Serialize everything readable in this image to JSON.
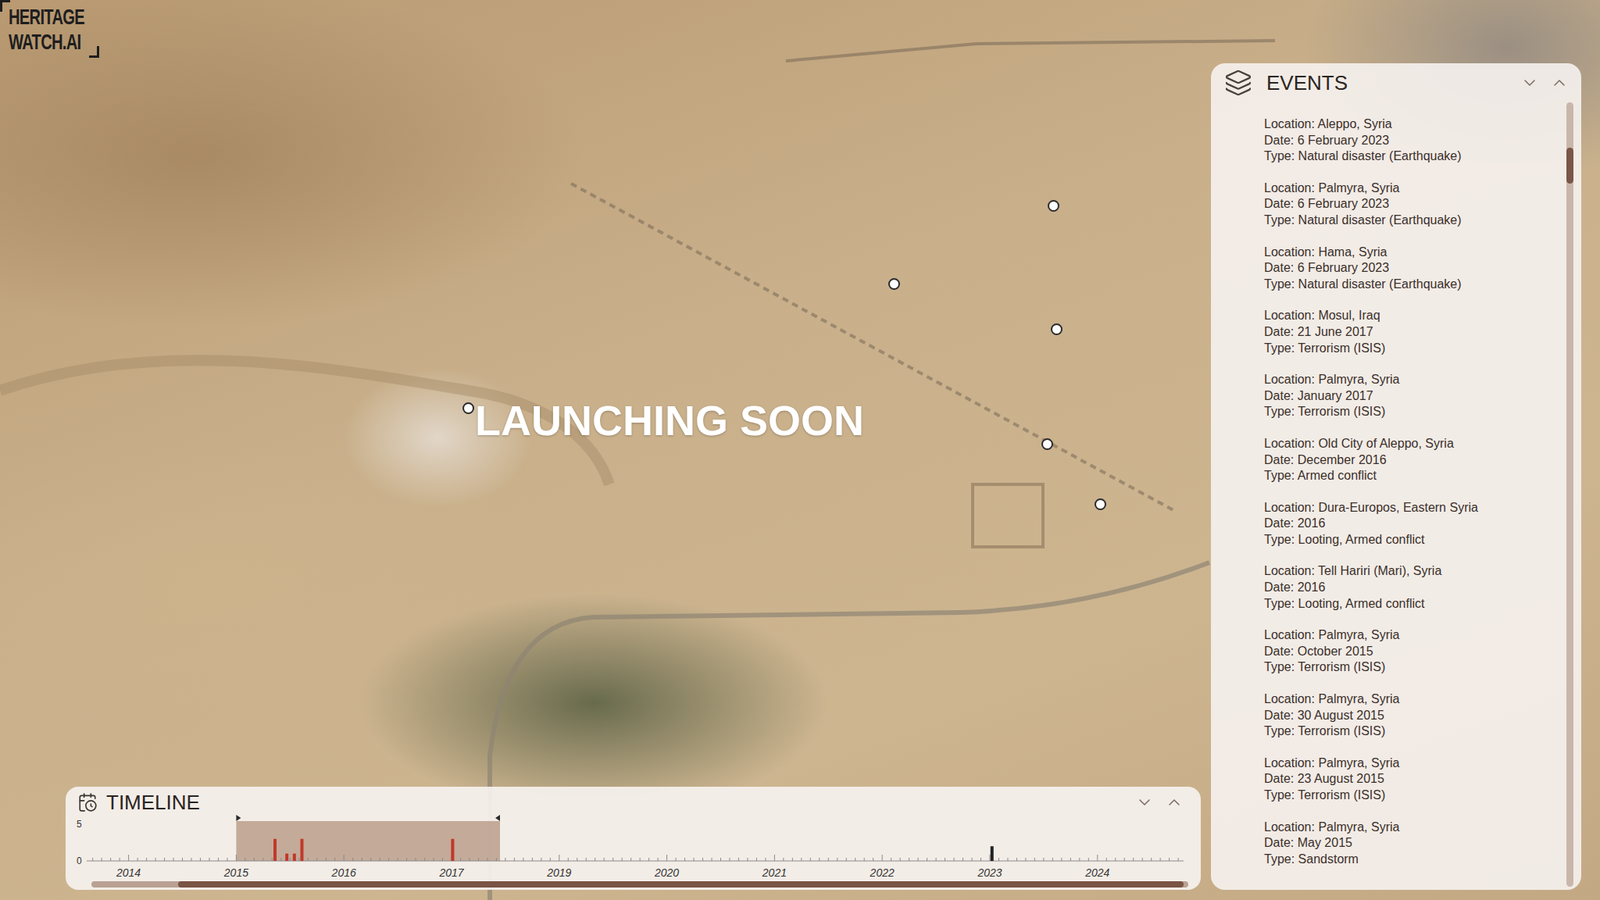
{
  "logo": {
    "lines": [
      "HERITAGE",
      "WATCH.AI"
    ]
  },
  "map": {
    "overlay": "LAUNCHING SOON"
  },
  "events": {
    "title": "EVENTS",
    "items": [
      {
        "location": "Location: Aleppo, Syria",
        "date": "Date: 6 February 2023",
        "type": "Type: Natural disaster (Earthquake)"
      },
      {
        "location": "Location: Palmyra, Syria",
        "date": "Date: 6 February 2023",
        "type": "Type: Natural disaster (Earthquake)"
      },
      {
        "location": "Location: Hama, Syria",
        "date": "Date: 6 February 2023",
        "type": "Type: Natural disaster (Earthquake)"
      },
      {
        "location": "Location: Mosul, Iraq",
        "date": "Date: 21 June 2017",
        "type": "Type: Terrorism (ISIS)"
      },
      {
        "location": "Location: Palmyra, Syria",
        "date": "Date: January 2017",
        "type": "Type: Terrorism (ISIS)"
      },
      {
        "location": "Location: Old City of Aleppo, Syria",
        "date": "Date: December 2016",
        "type": "Type: Armed conflict"
      },
      {
        "location": "Location: Dura-Europos, Eastern Syria",
        "date": "Date: 2016",
        "type": "Type: Looting, Armed conflict"
      },
      {
        "location": "Location: Tell Hariri (Mari), Syria",
        "date": "Date: 2016",
        "type": "Type: Looting, Armed conflict"
      },
      {
        "location": "Location: Palmyra, Syria",
        "date": "Date: October 2015",
        "type": "Type: Terrorism (ISIS)"
      },
      {
        "location": "Location: Palmyra, Syria",
        "date": "Date: 30 August 2015",
        "type": "Type: Terrorism (ISIS)"
      },
      {
        "location": "Location: Palmyra, Syria",
        "date": "Date: 23 August 2015",
        "type": "Type: Terrorism (ISIS)"
      },
      {
        "location": "Location: Palmyra, Syria",
        "date": "Date: May 2015",
        "type": "Type: Sandstorm"
      }
    ]
  },
  "timeline": {
    "title": "TIMELINE",
    "y_max": 5,
    "y_ticks": [
      "5",
      "0"
    ],
    "x_ticks": [
      "2014",
      "2015",
      "2016",
      "2017",
      "2019",
      "2020",
      "2021",
      "2022",
      "2023",
      "2024"
    ],
    "selection": [
      1.0,
      3.45
    ],
    "series": [
      {
        "name": "in-range",
        "color": "#c0392b",
        "positions": [
          1.36,
          1.47,
          1.54,
          1.61,
          3.01
        ],
        "values": [
          3,
          1,
          1,
          3,
          3
        ]
      },
      {
        "name": "out-of-range",
        "color": "#222222",
        "positions": [
          8.02
        ],
        "values": [
          2
        ]
      }
    ]
  }
}
